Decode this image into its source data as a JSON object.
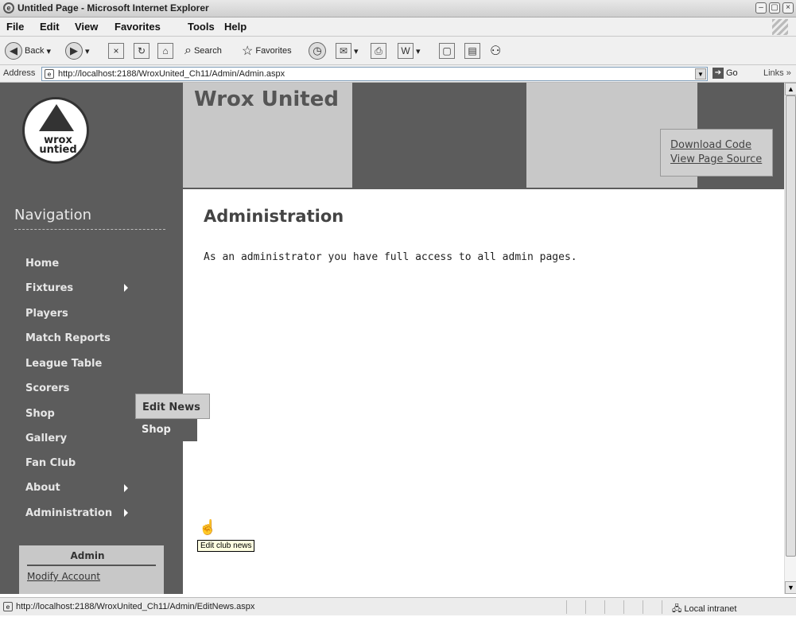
{
  "window": {
    "title": "Untitled Page - Microsoft Internet Explorer",
    "controls": [
      "–",
      "▢",
      "×"
    ]
  },
  "menu": [
    "File",
    "Edit",
    "View",
    "Favorites",
    "Tools",
    "Help"
  ],
  "toolbar": {
    "back": "Back",
    "search": "Search",
    "favorites": "Favorites"
  },
  "address": {
    "label": "Address",
    "url": "http://localhost:2188/WroxUnited_Ch11/Admin/Admin.aspx",
    "go": "Go",
    "links": "Links"
  },
  "site": {
    "logo_text": "wrox\nunited",
    "title": "Wrox United",
    "download_code": "Download Code",
    "view_source": "View Page Source"
  },
  "nav": {
    "heading": "Navigation",
    "items": [
      {
        "label": "Home",
        "has_sub": false
      },
      {
        "label": "Fixtures",
        "has_sub": true
      },
      {
        "label": "Players",
        "has_sub": false
      },
      {
        "label": "Match Reports",
        "has_sub": false
      },
      {
        "label": "League Table",
        "has_sub": false
      },
      {
        "label": "Scorers",
        "has_sub": false
      },
      {
        "label": "Shop",
        "has_sub": false
      },
      {
        "label": "Gallery",
        "has_sub": false
      },
      {
        "label": "Fan Club",
        "has_sub": false
      },
      {
        "label": "About",
        "has_sub": true
      },
      {
        "label": "Administration",
        "has_sub": true
      }
    ],
    "flyout": [
      "Edit News",
      "Shop"
    ],
    "tooltip": "Edit club news"
  },
  "admin_box": {
    "heading": "Admin",
    "link": "Modify Account"
  },
  "content": {
    "heading": "Administration",
    "text": "As an administrator you have full access to all admin pages."
  },
  "status": {
    "url": "http://localhost:2188/WroxUnited_Ch11/Admin/EditNews.aspx",
    "zone": "Local intranet"
  }
}
